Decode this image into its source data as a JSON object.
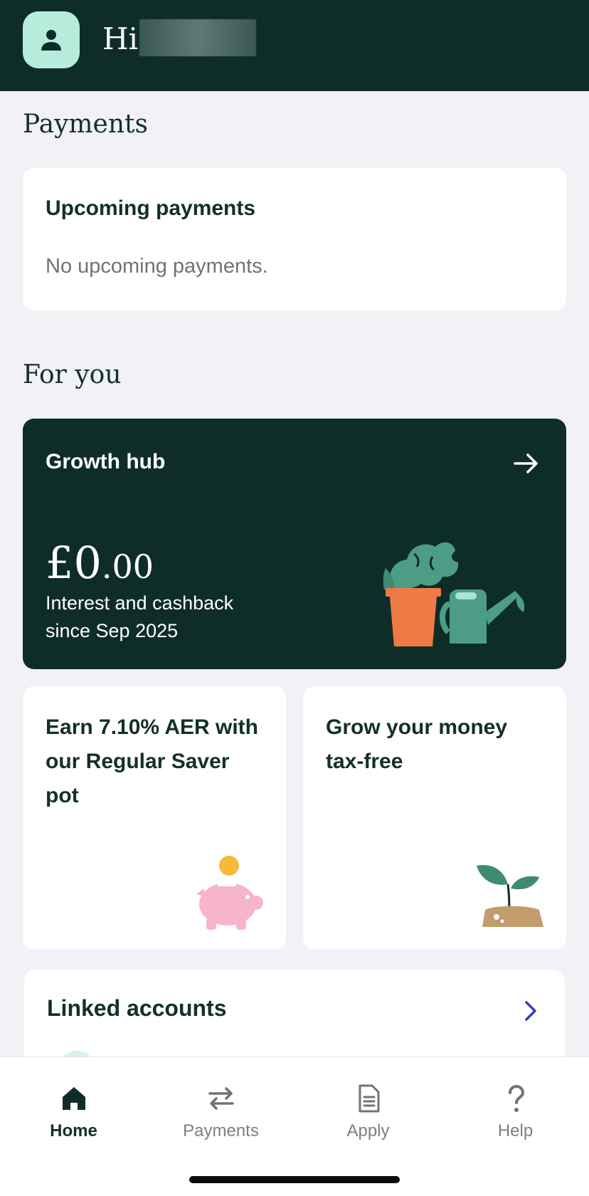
{
  "header": {
    "greeting": "Hi"
  },
  "payments": {
    "section_title": "Payments",
    "upcoming_title": "Upcoming payments",
    "upcoming_empty": "No upcoming payments."
  },
  "for_you": {
    "section_title": "For you",
    "growth_hub": {
      "title": "Growth hub",
      "amount_major": "£0",
      "amount_minor": ".00",
      "description": "Interest and cashback since Sep 2025"
    },
    "promo_saver": "Earn 7.10% AER with our Regular Saver pot",
    "promo_tax_free": "Grow your money tax-free"
  },
  "linked_accounts": {
    "title": "Linked accounts"
  },
  "tabbar": {
    "home": "Home",
    "payments": "Payments",
    "apply": "Apply",
    "help": "Help"
  },
  "icons": [
    "person-icon",
    "arrow-right-icon",
    "chevron-right-icon",
    "home-icon",
    "transfer-icon",
    "document-icon",
    "help-icon"
  ],
  "colors": {
    "brand_dark": "#0f2d28",
    "accent_mint": "#b7ecdc",
    "link_blue": "#3b3fb5"
  }
}
